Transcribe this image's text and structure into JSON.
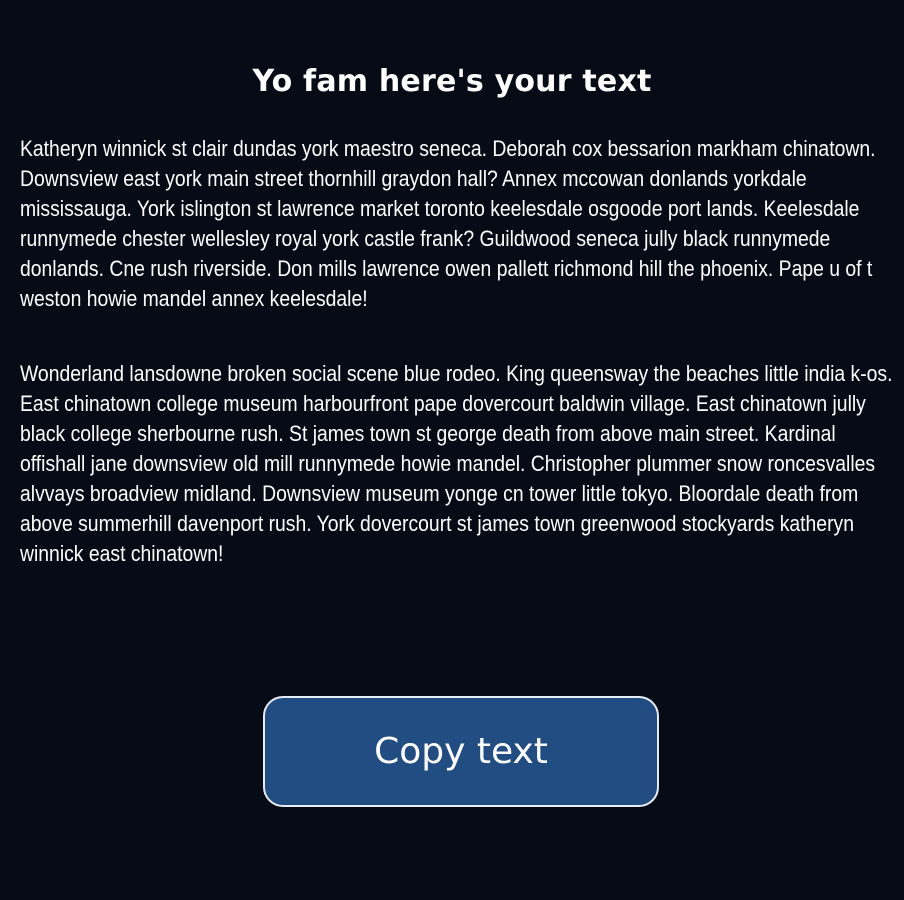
{
  "page": {
    "title": "Yo fam here's your text",
    "paragraphs": [
      "Katheryn winnick st clair dundas york maestro seneca. Deborah cox bessarion markham chinatown. Downsview east york main street thornhill graydon hall? Annex mccowan donlands yorkdale mississauga. York islington st lawrence market toronto keelesdale osgoode port lands. Keelesdale runnymede chester wellesley royal york castle frank? Guildwood seneca jully black runnymede donlands. Cne rush riverside. Don mills lawrence owen pallett richmond hill the phoenix. Pape u of t weston howie mandel annex keelesdale!",
      "Wonderland lansdowne broken social scene blue rodeo. King queensway the beaches little india k-os. East chinatown college museum harbourfront pape dovercourt baldwin village. East chinatown jully black college sherbourne rush. St james town st george death from above main street. Kardinal offishall jane downsview old mill runnymede howie mandel. Christopher plummer snow roncesvalles alvvays broadview midland. Downsview museum yonge cn tower little tokyo. Bloordale death from above summerhill davenport rush. York dovercourt st james town greenwood stockyards katheryn winnick east chinatown!"
    ],
    "copy_button_label": "Copy text"
  },
  "colors": {
    "background": "#060b16",
    "button_fill": "#214d82",
    "button_border": "#e6ecf5",
    "text": "#ffffff"
  }
}
